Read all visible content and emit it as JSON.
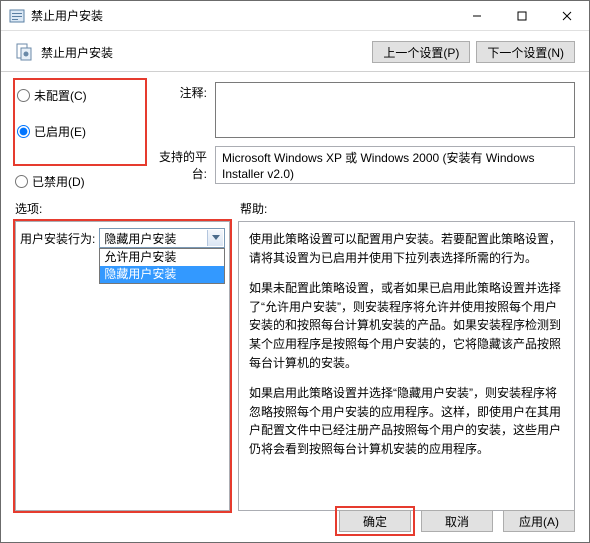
{
  "window": {
    "title": "禁止用户安装",
    "minimize": "—",
    "maximize": "□",
    "close": "✕"
  },
  "header": {
    "title": "禁止用户安装",
    "prev_btn": "上一个设置(P)",
    "next_btn": "下一个设置(N)"
  },
  "radios": {
    "not_configured": "未配置(C)",
    "enabled": "已启用(E)",
    "disabled": "已禁用(D)",
    "selected": "enabled"
  },
  "form": {
    "comment_label": "注释:",
    "comment_value": "",
    "platform_label": "支持的平台:",
    "platform_value": "Microsoft Windows XP 或 Windows 2000 (安装有 Windows Installer v2.0)"
  },
  "sections": {
    "options_label": "选项:",
    "help_label": "帮助:"
  },
  "options": {
    "behavior_label": "用户安装行为:",
    "selected": "隐藏用户安装",
    "items": [
      "允许用户安装",
      "隐藏用户安装"
    ]
  },
  "help": {
    "p1": "使用此策略设置可以配置用户安装。若要配置此策略设置，请将其设置为已启用并使用下拉列表选择所需的行为。",
    "p2": "如果未配置此策略设置，或者如果已启用此策略设置并选择了“允许用户安装”，则安装程序将允许并使用按照每个用户安装的和按照每台计算机安装的产品。如果安装程序检测到某个应用程序是按照每个用户安装的，它将隐藏该产品按照每台计算机的安装。",
    "p3": "如果启用此策略设置并选择“隐藏用户安装”，则安装程序将忽略按照每个用户安装的应用程序。这样，即使用户在其用户配置文件中已经注册产品按照每个用户的安装，这些用户仍将会看到按照每台计算机安装的应用程序。"
  },
  "footer": {
    "ok": "确定",
    "cancel": "取消",
    "apply": "应用(A)"
  },
  "icons": {
    "app": "policy-icon",
    "chevron": "▾"
  }
}
